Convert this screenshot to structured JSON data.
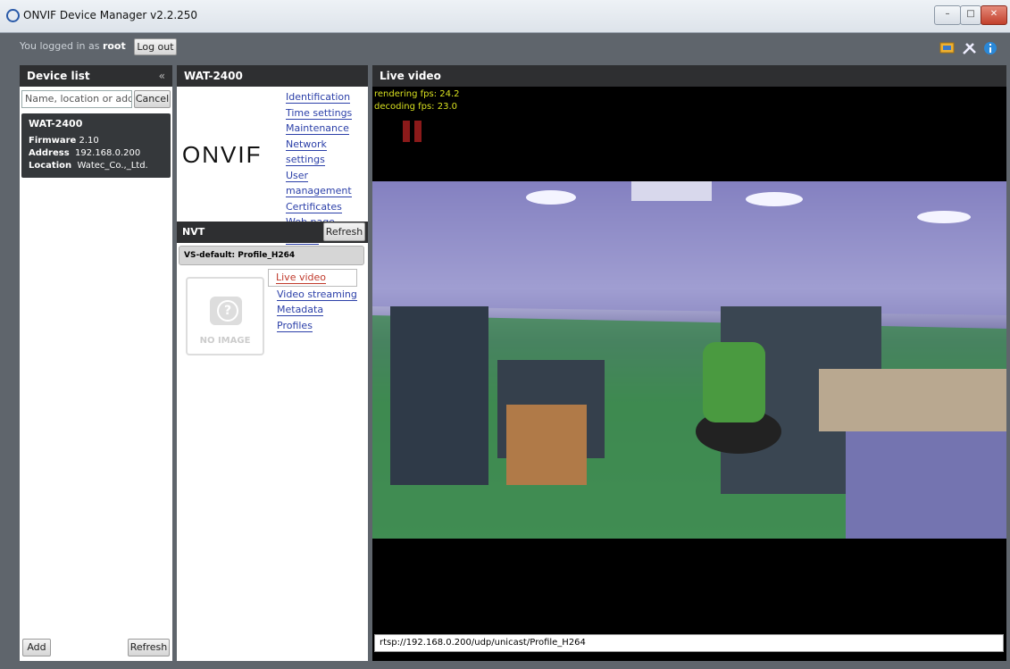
{
  "window": {
    "title": "ONVIF Device Manager v2.2.250"
  },
  "topbar": {
    "logged_prefix": "You logged in as",
    "user": "root",
    "logout_label": "Log out"
  },
  "device_list": {
    "title": "Device list",
    "collapse_glyph": "«",
    "search_placeholder": "Name, location or address",
    "search_display": "Name, location or address",
    "cancel_label": "Cancel",
    "device": {
      "name": "WAT-2400",
      "firmware_label": "Firmware",
      "firmware": "2.10",
      "address_label": "Address",
      "address": "192.168.0.200",
      "location_label": "Location",
      "location": "Watec_Co.,_Ltd."
    },
    "add_label": "Add",
    "refresh_label": "Refresh"
  },
  "device_panel": {
    "title": "WAT-2400",
    "logo_text": "ONVIF",
    "links": [
      "Identification",
      "Time settings",
      "Maintenance",
      "Network settings",
      "User management",
      "Certificates",
      "Web page",
      "Events"
    ],
    "nvt": {
      "title": "NVT",
      "refresh_label": "Refresh",
      "profile": "VS-default: Profile_H264",
      "no_image": "NO IMAGE",
      "links": [
        "Live video",
        "Video streaming",
        "Metadata",
        "Profiles"
      ]
    }
  },
  "live": {
    "title": "Live video",
    "rendering_fps": "rendering fps: 24.2",
    "decoding_fps": "decoding fps: 23.0",
    "url": "rtsp://192.168.0.200/udp/unicast/Profile_H264"
  },
  "colors": {
    "header": "#2e2f31",
    "link": "#2b3fa8",
    "active_link": "#c0392b",
    "fps_text": "#d8e020",
    "pause": "#8b1a1a"
  },
  "icons": [
    "monitor-icon",
    "tools-icon",
    "info-icon"
  ]
}
